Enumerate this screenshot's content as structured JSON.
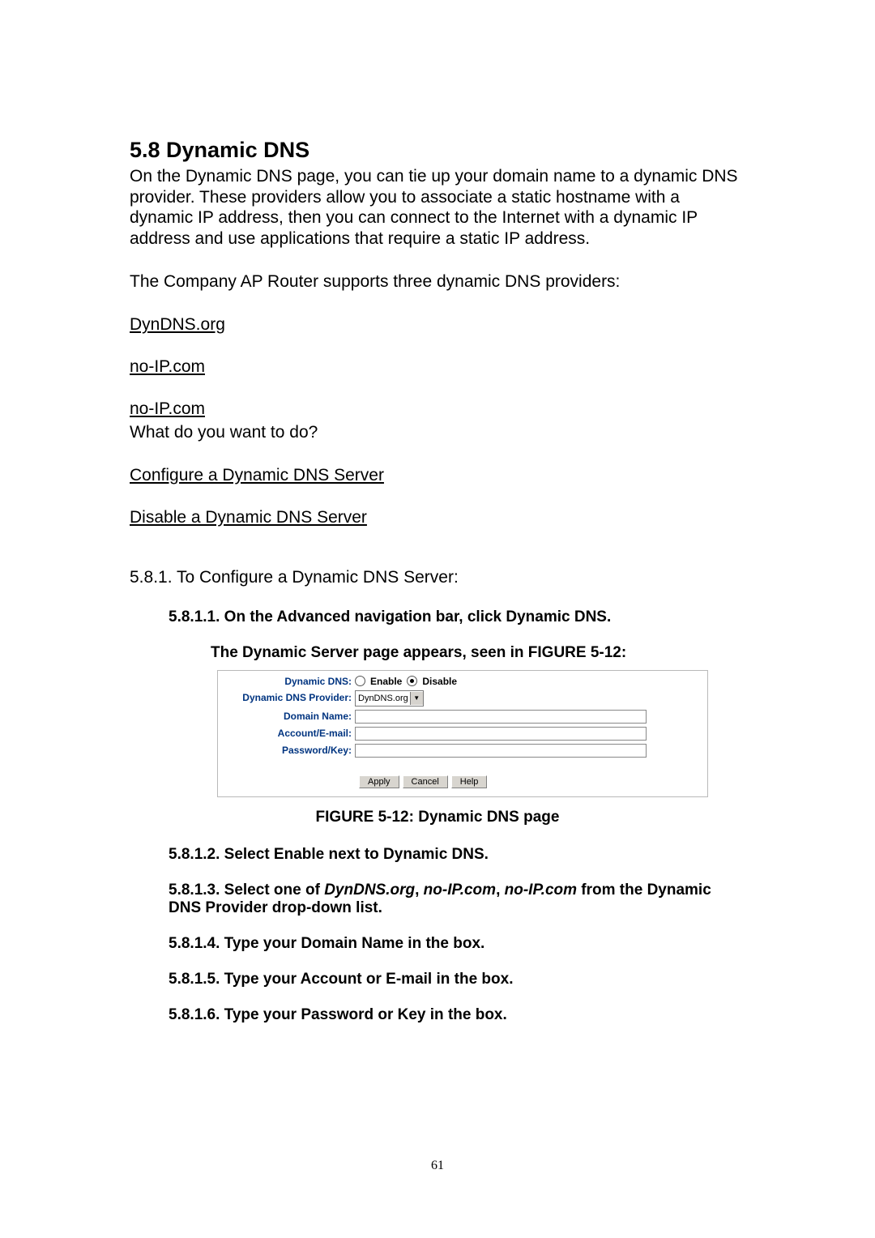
{
  "header": {
    "section_title": "5.8 Dynamic DNS"
  },
  "intro": {
    "p1": "On the Dynamic DNS page, you can tie up your domain name to a dynamic DNS provider. These providers allow you to associate a static hostname with a dynamic IP address, then you can connect to the Internet with a dynamic IP address and use applications that require a static IP address.",
    "p2": "The Company AP Router supports three dynamic DNS providers:"
  },
  "links": {
    "dyndns": "DynDNS.org",
    "noip1": "no-IP.com",
    "noip2": "no-IP.com",
    "question": "What do you want to do?",
    "configure": "Configure a Dynamic DNS Server",
    "disable": "Disable a Dynamic DNS Server"
  },
  "sub": {
    "title_581": "5.8.1. To Configure a Dynamic DNS Server:"
  },
  "steps": {
    "s1_a": "5.8.1.1. On the Advanced navigation bar, click Dynamic DNS.",
    "s1_b": "The Dynamic Server page appears, seen in FIGURE 5-12:",
    "caption": "FIGURE 5-12: Dynamic DNS page",
    "s2": "5.8.1.2. Select Enable next to Dynamic DNS.",
    "s3_pre": "5.8.1.3. Select one of ",
    "s3_i1": "DynDNS.org",
    "s3_c1": ", ",
    "s3_i2": "no-IP.com",
    "s3_c2": ", ",
    "s3_i3": "no-IP.com",
    "s3_post": " from the Dynamic DNS Provider drop-down list.",
    "s4": "5.8.1.4. Type your Domain Name in the box.",
    "s5": "5.8.1.5. Type your Account or E-mail in the box.",
    "s6": "5.8.1.6. Type your Password or Key in the box."
  },
  "figure": {
    "labels": {
      "ddns": "Dynamic DNS:",
      "provider": "Dynamic DNS Provider:",
      "domain": "Domain Name:",
      "account": "Account/E-mail:",
      "password": "Password/Key:"
    },
    "radio_enable": "Enable",
    "radio_disable": "Disable",
    "select_value": "DynDNS.org",
    "btn_apply": "Apply",
    "btn_cancel": "Cancel",
    "btn_help": "Help"
  },
  "page_number": "61"
}
